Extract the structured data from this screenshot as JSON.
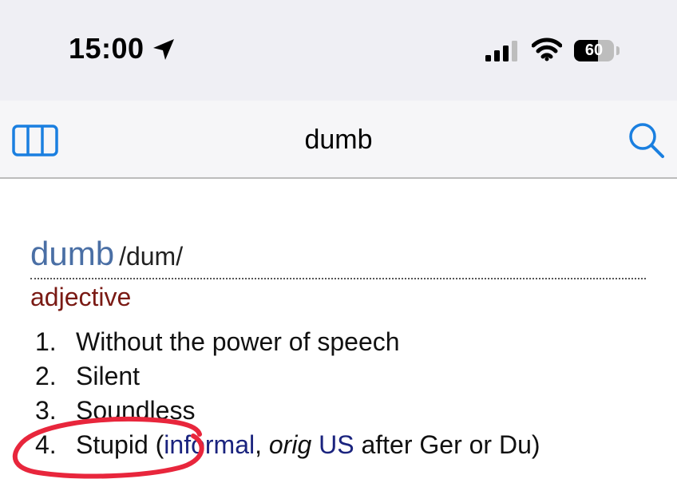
{
  "status_bar": {
    "time": "15:00",
    "battery": "60",
    "icons": [
      "location-arrow-icon",
      "cellular-signal-icon",
      "wifi-icon",
      "battery-icon"
    ]
  },
  "nav": {
    "title": "dumb",
    "left_icon": "sidebar-icon",
    "right_icon": "search-icon",
    "accent_color": "#1a7fe0"
  },
  "entry": {
    "headword": "dumb",
    "pronunciation": "/dum/",
    "part_of_speech": "adjective",
    "senses": [
      {
        "number": "1.",
        "text": "Without the power of speech"
      },
      {
        "number": "2.",
        "text": "Silent"
      },
      {
        "number": "3.",
        "text": "Soundless"
      },
      {
        "number": "4.",
        "text_before": "Stupid (",
        "link_informal": "informal",
        "comma": ", ",
        "orig": "orig",
        "space": " ",
        "link_us": "US",
        "text_after": " after Ger or Du)"
      }
    ]
  },
  "annotation": {
    "type": "hand-drawn circle",
    "color": "#e8263c"
  }
}
